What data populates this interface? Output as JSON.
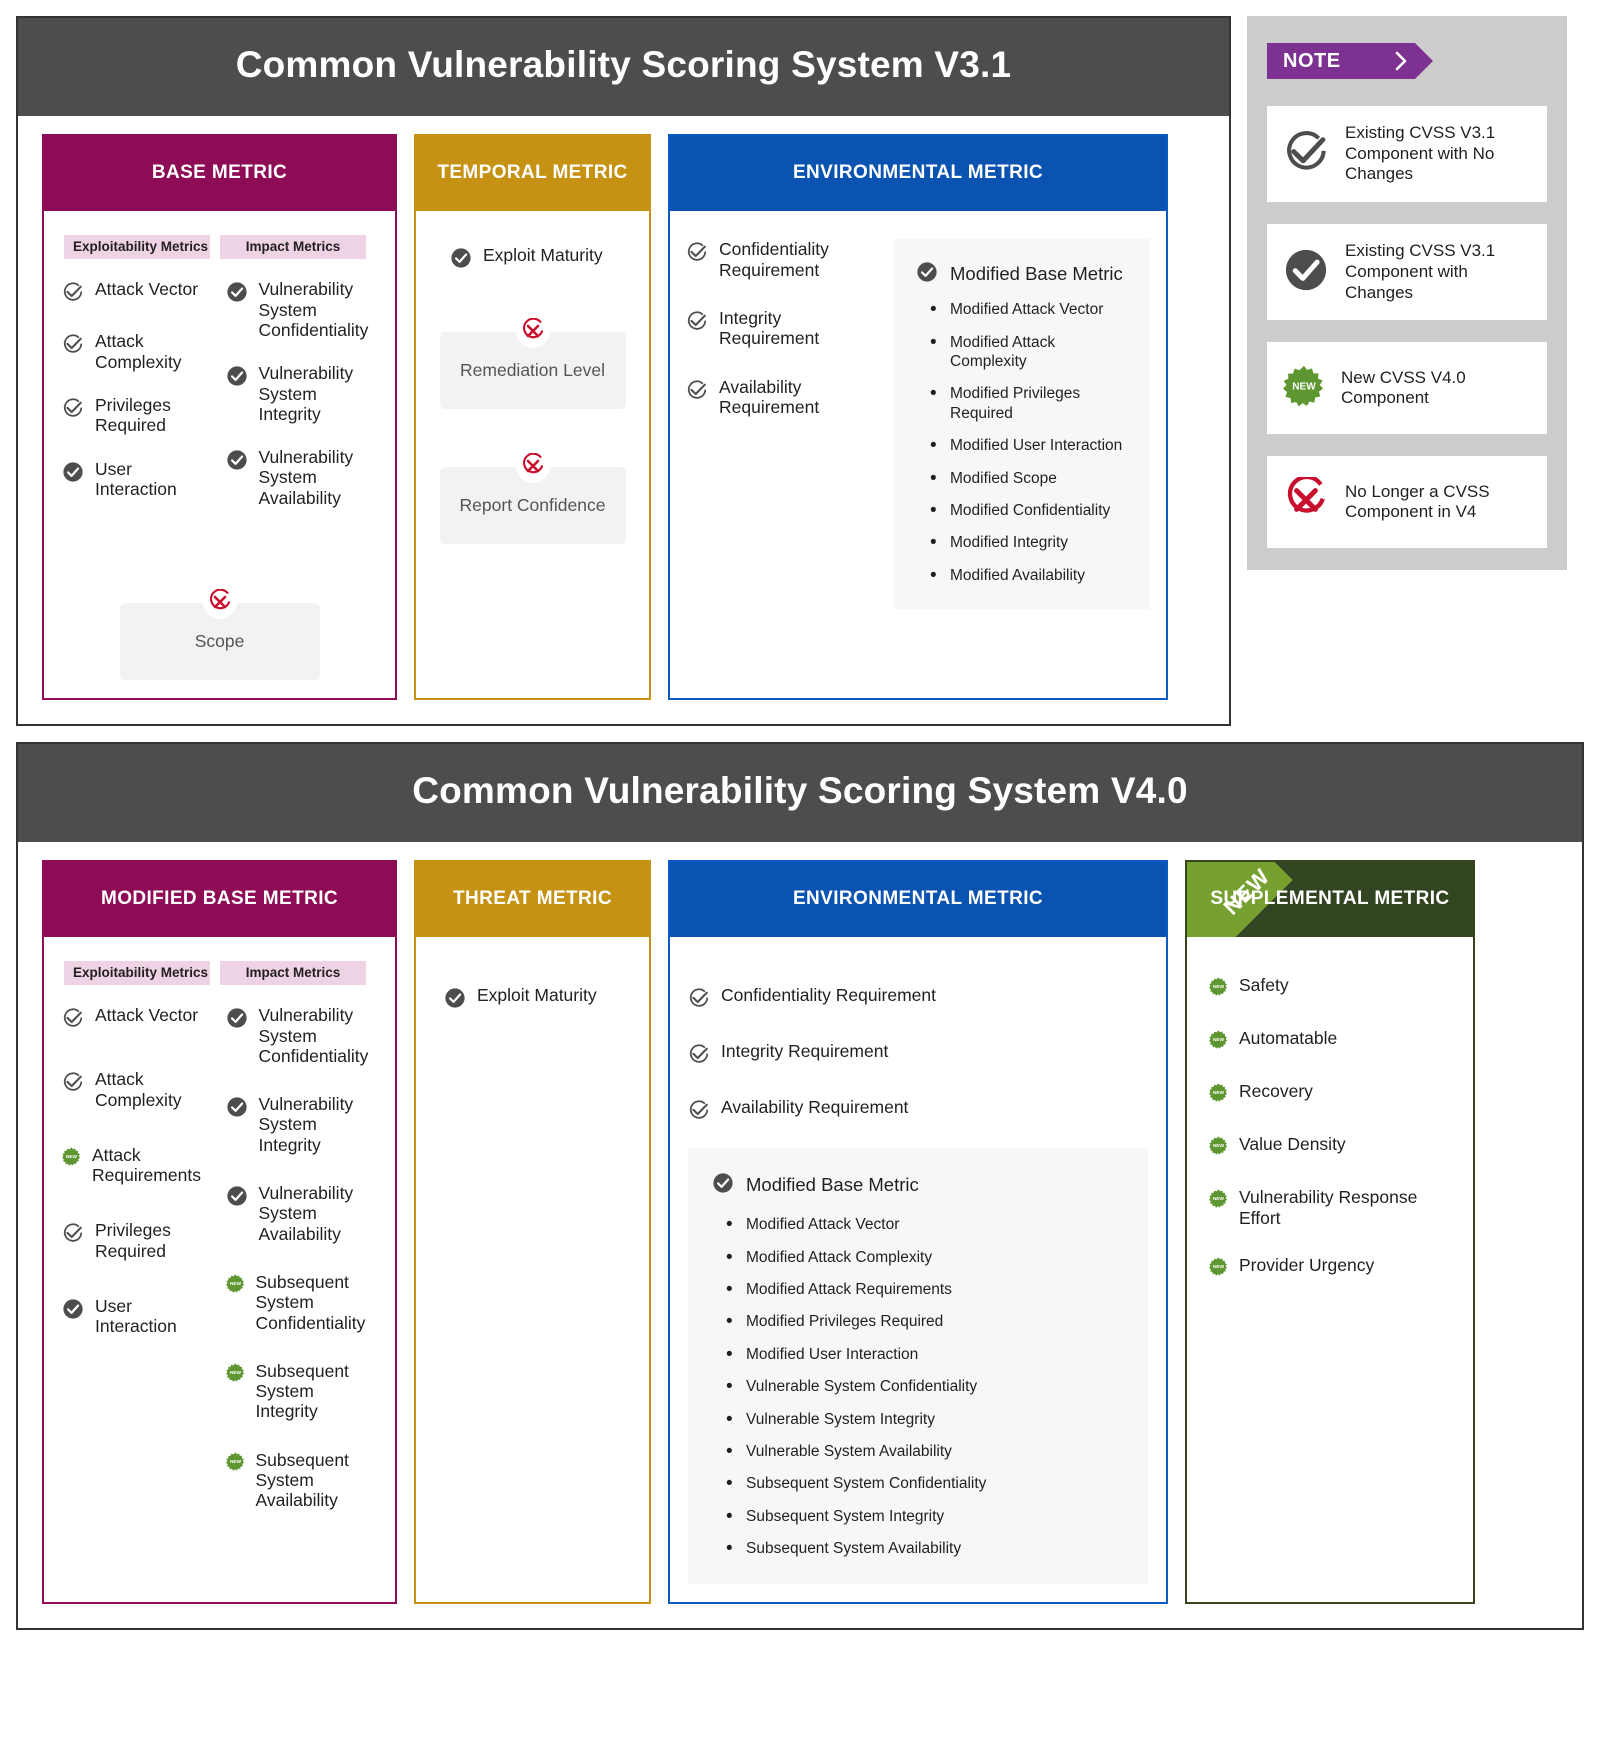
{
  "colors": {
    "header_grey": "#4d4d4d",
    "base_magenta": "#8e0c55",
    "temporal_gold": "#c69214",
    "env_blue": "#0b53b0",
    "suppl_green": "#324420",
    "ribbon_green": "#76a030",
    "note_purple": "#7d3291",
    "legend_grey": "#cccccc",
    "removed_red": "#c8102e",
    "new_badge_green": "#5e9732"
  },
  "v31": {
    "title": "Common Vulnerability Scoring System V3.1",
    "base": {
      "header": "BASE METRIC",
      "pills": [
        "Exploitability Metrics",
        "Impact Metrics"
      ],
      "exploitability": [
        {
          "label": "Attack Vector",
          "icon": "check-outline-icon"
        },
        {
          "label": "Attack Complexity",
          "icon": "check-outline-icon"
        },
        {
          "label": "Privileges Required",
          "icon": "check-outline-icon"
        },
        {
          "label": "User Interaction",
          "icon": "check-filled-icon"
        }
      ],
      "impact": [
        {
          "label": "Vulnerability System Confidentiality",
          "icon": "check-filled-icon"
        },
        {
          "label": "Vulnerability System Integrity",
          "icon": "check-filled-icon"
        },
        {
          "label": "Vulnerability System Availability",
          "icon": "check-filled-icon"
        }
      ],
      "removed": [
        {
          "label": "Scope",
          "icon": "removed-x-icon"
        }
      ]
    },
    "temporal": {
      "header": "TEMPORAL METRIC",
      "items": [
        {
          "label": "Exploit Maturity",
          "icon": "check-filled-icon"
        }
      ],
      "removed": [
        {
          "label": "Remediation Level",
          "icon": "removed-x-icon"
        },
        {
          "label": "Report Confidence",
          "icon": "removed-x-icon"
        }
      ]
    },
    "environmental": {
      "header": "ENVIRONMENTAL METRIC",
      "requirements": [
        {
          "label": "Confidentiality Requirement",
          "icon": "check-outline-icon"
        },
        {
          "label": "Integrity Requirement",
          "icon": "check-outline-icon"
        },
        {
          "label": "Availability Requirement",
          "icon": "check-outline-icon"
        }
      ],
      "subpanel": {
        "title": "Modified Base Metric",
        "icon": "check-filled-icon",
        "items": [
          "Modified Attack Vector",
          "Modified Attack Complexity",
          "Modified Privileges Required",
          "Modified User Interaction",
          "Modified Scope",
          "Modified Confidentiality",
          "Modified Integrity",
          "Modified Availability"
        ]
      }
    }
  },
  "legend": {
    "tag": "NOTE",
    "items": [
      {
        "icon": "check-outline-icon",
        "text": "Existing CVSS V3.1 Component with No Changes"
      },
      {
        "icon": "check-filled-icon",
        "text": "Existing CVSS V3.1 Component with Changes"
      },
      {
        "icon": "new-badge-icon",
        "text": "New CVSS V4.0 Component"
      },
      {
        "icon": "removed-x-icon",
        "text": "No Longer a CVSS Component in V4"
      }
    ]
  },
  "v40": {
    "title": "Common Vulnerability Scoring System V4.0",
    "base": {
      "header": "MODIFIED BASE METRIC",
      "pills": [
        "Exploitability Metrics",
        "Impact Metrics"
      ],
      "exploitability": [
        {
          "label": "Attack Vector",
          "icon": "check-outline-icon"
        },
        {
          "label": "Attack Complexity",
          "icon": "check-outline-icon"
        },
        {
          "label": "Attack Requirements",
          "icon": "new-badge-icon"
        },
        {
          "label": "Privileges Required",
          "icon": "check-outline-icon"
        },
        {
          "label": "User Interaction",
          "icon": "check-filled-icon"
        }
      ],
      "impact": [
        {
          "label": "Vulnerability System Confidentiality",
          "icon": "check-filled-icon"
        },
        {
          "label": "Vulnerability System Integrity",
          "icon": "check-filled-icon"
        },
        {
          "label": "Vulnerability System Availability",
          "icon": "check-filled-icon"
        },
        {
          "label": "Subsequent System Confidentiality",
          "icon": "new-badge-icon"
        },
        {
          "label": "Subsequent System Integrity",
          "icon": "new-badge-icon"
        },
        {
          "label": "Subsequent System Availability",
          "icon": "new-badge-icon"
        }
      ]
    },
    "threat": {
      "header": "THREAT METRIC",
      "items": [
        {
          "label": "Exploit Maturity",
          "icon": "check-filled-icon"
        }
      ]
    },
    "environmental": {
      "header": "ENVIRONMENTAL METRIC",
      "requirements": [
        {
          "label": "Confidentiality Requirement",
          "icon": "check-outline-icon"
        },
        {
          "label": "Integrity  Requirement",
          "icon": "check-outline-icon"
        },
        {
          "label": "Availability Requirement",
          "icon": "check-outline-icon"
        }
      ],
      "subpanel": {
        "title": "Modified Base Metric",
        "icon": "check-filled-icon",
        "items": [
          "Modified Attack Vector",
          "Modified Attack Complexity",
          "Modified Attack Requirements",
          "Modified Privileges Required",
          "Modified User Interaction",
          "Vulnerable System Confidentiality",
          "Vulnerable System Integrity",
          "Vulnerable System Availability",
          "Subsequent System Confidentiality",
          "Subsequent System Integrity",
          "Subsequent System Availability"
        ]
      }
    },
    "supplemental": {
      "header": "SUPPLEMENTAL METRIC",
      "ribbon": "NEW",
      "items": [
        {
          "label": "Safety",
          "icon": "new-badge-icon"
        },
        {
          "label": "Automatable",
          "icon": "new-badge-icon"
        },
        {
          "label": "Recovery",
          "icon": "new-badge-icon"
        },
        {
          "label": "Value Density",
          "icon": "new-badge-icon"
        },
        {
          "label": "Vulnerability Response Effort",
          "icon": "new-badge-icon"
        },
        {
          "label": "Provider Urgency",
          "icon": "new-badge-icon"
        }
      ]
    }
  }
}
